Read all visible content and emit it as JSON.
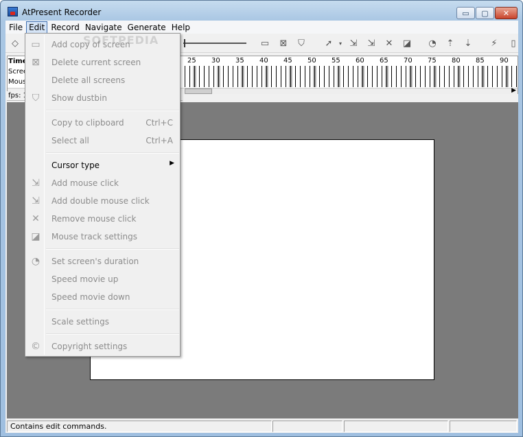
{
  "window": {
    "title": "AtPresent Recorder",
    "controls": {
      "minimize": "▭",
      "maximize": "▢",
      "close": "✕"
    }
  },
  "menubar": [
    "File",
    "Edit",
    "Record",
    "Navigate",
    "Generate",
    "Help"
  ],
  "timeline": {
    "row_labels": [
      "Time",
      "Scree",
      "Mous"
    ],
    "tick_numbers": [
      "25",
      "30",
      "35",
      "40",
      "45",
      "50",
      "55",
      "60",
      "65",
      "70",
      "75",
      "80",
      "85",
      "90"
    ],
    "fps_label": "fps: 1"
  },
  "edit_menu": {
    "items": [
      {
        "label": "Add copy of screen",
        "icon": "screen-copy-icon",
        "enabled": false
      },
      {
        "label": "Delete current screen",
        "icon": "screen-delete-icon",
        "enabled": false
      },
      {
        "label": "Delete all screens",
        "icon": "",
        "enabled": false
      },
      {
        "label": "Show dustbin",
        "icon": "dustbin-icon",
        "enabled": false
      },
      {
        "label": "Copy to clipboard",
        "shortcut": "Ctrl+C",
        "enabled": false
      },
      {
        "label": "Select all",
        "shortcut": "Ctrl+A",
        "enabled": false
      },
      {
        "label": "Cursor type",
        "enabled": true,
        "submenu": true
      },
      {
        "label": "Add mouse click",
        "icon": "mouse-click-icon",
        "enabled": false
      },
      {
        "label": "Add double mouse click",
        "icon": "double-click-icon",
        "enabled": false
      },
      {
        "label": "Remove mouse click",
        "icon": "remove-click-icon",
        "enabled": false
      },
      {
        "label": "Mouse track settings",
        "icon": "mouse-track-icon",
        "enabled": false
      },
      {
        "label": "Set screen's duration",
        "icon": "duration-icon",
        "enabled": false
      },
      {
        "label": "Speed movie up",
        "enabled": false
      },
      {
        "label": "Speed movie down",
        "enabled": false
      },
      {
        "label": "Scale settings",
        "enabled": false
      },
      {
        "label": "Copyright settings",
        "icon": "copyright-icon",
        "enabled": false
      }
    ],
    "watermark": "SOFTPEDIA"
  },
  "statusbar": {
    "text": "Contains edit commands."
  }
}
